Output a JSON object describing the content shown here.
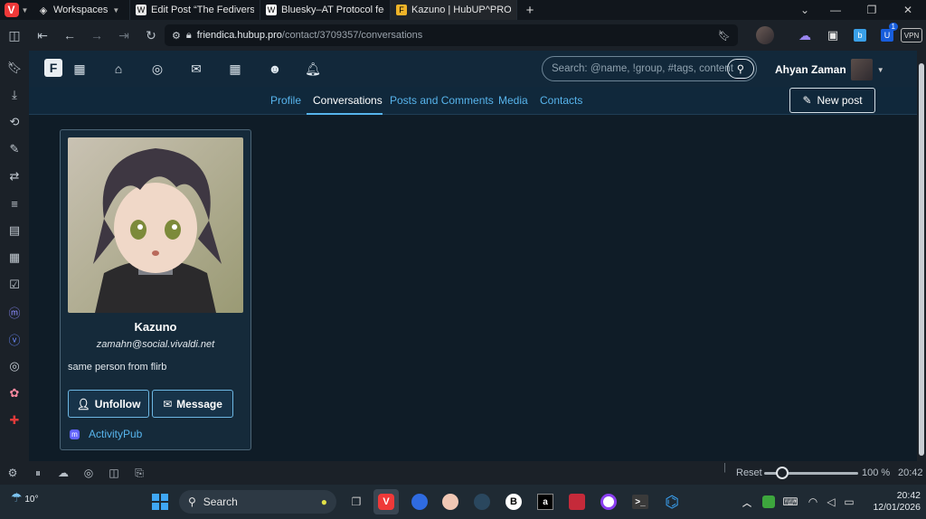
{
  "browser": {
    "tabs": [
      {
        "label": "Workspaces",
        "icon": "workspaces-icon"
      },
      {
        "label": "Edit Post “The Fediverse: So",
        "icon": "wordpress-icon"
      },
      {
        "label": "Bluesky–AT Protocol federa",
        "icon": "wikipedia-icon"
      },
      {
        "label": "Kazuno | HubUP^PRO Colle",
        "icon": "friendica-icon"
      }
    ],
    "new_tab": "+",
    "url_host": "friendica.hubup.pro",
    "url_path": "/contact/3709357/conversations",
    "vpn_label": "VPN",
    "notif_count": "1"
  },
  "site": {
    "search_placeholder": "Search: @name, !group, #tags, content",
    "user_name": "Ahyan Zaman",
    "subnav": [
      "Profile",
      "Conversations",
      "Posts and Comments",
      "Media",
      "Contacts"
    ],
    "active_subnav": "Conversations",
    "new_post_label": "New post"
  },
  "contact": {
    "name": "Kazuno",
    "address": "zamahn@social.vivaldi.net",
    "bio": "same person from flirb",
    "unfollow_label": "Unfollow",
    "message_label": "Message",
    "network": "ActivityPub"
  },
  "statusbar": {
    "reset_label": "Reset",
    "zoom": "100 %",
    "time": "20:42"
  },
  "taskbar": {
    "weather": "10°",
    "search_label": "Search",
    "clock_time": "20:42",
    "clock_date": "12/01/2026"
  }
}
